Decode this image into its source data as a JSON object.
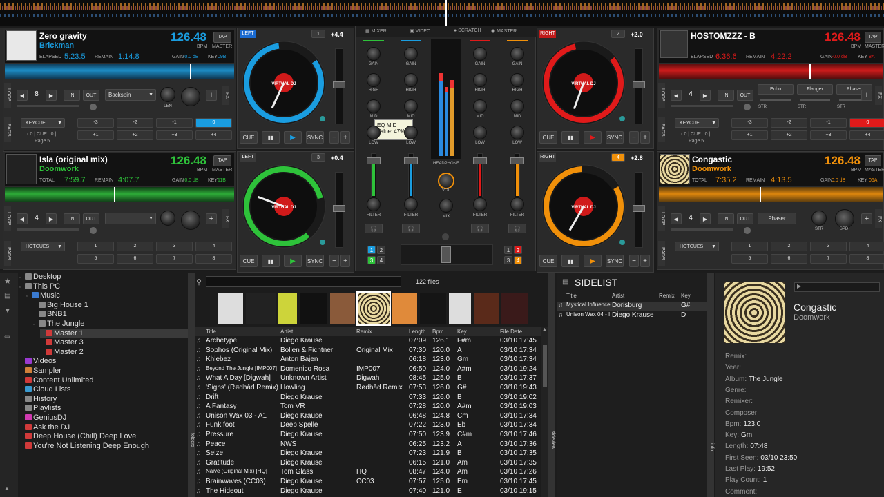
{
  "decks": {
    "d1": {
      "side": "LEFT",
      "num": "1",
      "pitch": "+4.4",
      "title": "Zero gravity",
      "artist": "Brickman",
      "bpm": "126.48",
      "bpm_unit": "BPM",
      "master": "MASTER",
      "tap": "TAP",
      "elapsed_label": "ELAPSED",
      "elapsed": "5:23.5",
      "remain_label": "REMAIN",
      "remain": "1:14.8",
      "gain": "GAIN",
      "gain_val": "-0.0 dB",
      "key": "KEY",
      "key_val": "09B",
      "loop": "8",
      "in": "IN",
      "out": "OUT",
      "effect": "Backspin",
      "len": "LEN",
      "pad_mode": "KEYCUE",
      "pads": [
        "-3",
        "-2",
        "-1",
        "0",
        "+1",
        "+2",
        "+3",
        "+4"
      ],
      "page_info": "♪ 0 | CUE : 0 |",
      "page": "Page 5",
      "color": "#1a9de0"
    },
    "d3": {
      "side": "LEFT",
      "num": "3",
      "pitch": "+0.4",
      "title": "Isla (original mix)",
      "title_extra": "(original mix)",
      "artist": "Doomwork",
      "bpm": "126.48",
      "total_label": "TOTAL",
      "total": "7:59.7",
      "remain": "4:07.7",
      "gain_val": "-0.0 dB",
      "key_val": "11B",
      "loop": "4",
      "pad_mode": "HOTCUES",
      "pads": [
        "1",
        "2",
        "3",
        "4",
        "5",
        "6",
        "7",
        "8"
      ],
      "color": "#2ec23a"
    },
    "d2": {
      "side": "RIGHT",
      "num": "2",
      "pitch": "+2.0",
      "title": "HOSTOMZZZ - B",
      "bpm": "126.48",
      "elapsed": "6:36.6",
      "remain": "4:22.2",
      "gain_val": "-0.0 dB",
      "key_val": "8A",
      "loop": "4",
      "effects": [
        "Echo",
        "Flanger",
        "Phaser"
      ],
      "str": "STR",
      "pad_mode": "KEYCUE",
      "pads": [
        "-3",
        "-2",
        "-1",
        "0",
        "+1",
        "+2",
        "+3",
        "+4"
      ],
      "page_info": "♪ 0 | CUE : 0 |",
      "page": "Page 5",
      "color": "#e01a1a"
    },
    "d4": {
      "side": "RIGHT",
      "num": "4",
      "pitch": "+2.8",
      "title": "Congastic",
      "artist": "Doomwork",
      "bpm": "126.48",
      "total": "7:35.2",
      "remain": "4:13.5",
      "gain_val": "0.0 dB",
      "key_val": "06A",
      "loop": "4",
      "effect": "Phaser",
      "str": "STR",
      "spd": "SPD",
      "pad_mode": "HOTCUES",
      "pads": [
        "1",
        "2",
        "3",
        "4",
        "5",
        "6",
        "7",
        "8"
      ],
      "color": "#f0900a"
    }
  },
  "transport": {
    "cue": "CUE",
    "pause": "▮▮",
    "play": "▶",
    "sync": "SYNC",
    "minus": "−",
    "plus": "+"
  },
  "mixer": {
    "tabs": [
      "MIXER",
      "VIDEO",
      "SCRATCH",
      "MASTER"
    ],
    "gain": "GAIN",
    "high": "HIGH",
    "mid": "MID",
    "low": "LOW",
    "filter": "FILTER",
    "headphone": "HEADPHONE",
    "vol": "VOL",
    "mix": "MIX",
    "tooltip_title": "EQ MID",
    "tooltip_value": "Value: 47%",
    "deck_nums": [
      "1",
      "2",
      "3",
      "4"
    ]
  },
  "side_labels": {
    "loop": "LOOP",
    "pads": "PADS",
    "fx": "FX",
    "folders": "folders",
    "sideview": "sideview",
    "info": "info"
  },
  "browser": {
    "search_placeholder": "",
    "file_count": "122 files",
    "tree": [
      {
        "label": "Desktop",
        "indent": 0,
        "color": "#888"
      },
      {
        "label": "This PC",
        "indent": 0,
        "color": "#888"
      },
      {
        "label": "Music",
        "indent": 1,
        "color": "#3a7ad0"
      },
      {
        "label": "Big House 1",
        "indent": 2,
        "color": "#888"
      },
      {
        "label": "BNB1",
        "indent": 2,
        "color": "#888"
      },
      {
        "label": "The Jungle",
        "indent": 2,
        "color": "#888"
      },
      {
        "label": "Master 1",
        "indent": 3,
        "color": "#d03a3a",
        "selected": true
      },
      {
        "label": "Master 3",
        "indent": 3,
        "color": "#d03a3a"
      },
      {
        "label": "Master 2",
        "indent": 3,
        "color": "#d03a3a"
      },
      {
        "label": "Videos",
        "indent": 0,
        "color": "#9a3ad0"
      },
      {
        "label": "Sampler",
        "indent": 0,
        "color": "#d0803a"
      },
      {
        "label": "Content Unlimited",
        "indent": 0,
        "color": "#d03a3a"
      },
      {
        "label": "Cloud Lists",
        "indent": 0,
        "color": "#3a9ad0"
      },
      {
        "label": "History",
        "indent": 0,
        "color": "#888"
      },
      {
        "label": "Playlists",
        "indent": 0,
        "color": "#888"
      },
      {
        "label": "GeniusDJ",
        "indent": 0,
        "color": "#d03ab0"
      },
      {
        "label": "Ask the DJ",
        "indent": 0,
        "color": "#d03a3a"
      },
      {
        "label": "Deep House (Chill) Deep Love",
        "indent": 0,
        "color": "#d03a3a"
      },
      {
        "label": "You're Not Listening Deep Enough",
        "indent": 0,
        "color": "#d03a3a"
      }
    ],
    "columns": [
      "Title",
      "Artist",
      "Remix",
      "Length",
      "Bpm",
      "Key",
      "File Date"
    ],
    "rows": [
      [
        "Archetype",
        "Diego Krause",
        "",
        "07:09",
        "126.1",
        "F#m",
        "03/10 17:45"
      ],
      [
        "Sophos (Original Mix)",
        "Bollen & Fichtner",
        "Original Mix",
        "07:30",
        "120.0",
        "A",
        "03/10 17:34"
      ],
      [
        "Khlebez",
        "Anton Bajen",
        "",
        "06:18",
        "123.0",
        "Gm",
        "03/10 17:34"
      ],
      [
        "Beyond The Jungle [IMP007]",
        "Domenico Rosa",
        "IMP007",
        "06:50",
        "124.0",
        "A#m",
        "03/10 19:24"
      ],
      [
        "What A Day [Digwah]",
        "Unknown Artist",
        "Digwah",
        "08:45",
        "125.0",
        "B",
        "03/10 17:37"
      ],
      [
        "'Signs' (Rødhåd Remix)",
        "Howling",
        "Rødhåd Remix",
        "07:53",
        "126.0",
        "G#",
        "03/10 19:43"
      ],
      [
        "Drift",
        "Diego Krause",
        "",
        "07:33",
        "126.0",
        "B",
        "03/10 19:02"
      ],
      [
        "A Fantasy",
        "Tom VR",
        "",
        "07:28",
        "120.0",
        "A#m",
        "03/10 19:03"
      ],
      [
        "Unison Wax 03 - A1",
        "Diego Krause",
        "",
        "06:48",
        "124.8",
        "Cm",
        "03/10 17:34"
      ],
      [
        "Funk foot",
        "Deep Spelle",
        "",
        "07:22",
        "123.0",
        "Eb",
        "03/10 17:34"
      ],
      [
        "Pressure",
        "Diego Krause",
        "",
        "07:50",
        "123.9",
        "C#m",
        "03/10 17:46"
      ],
      [
        "Peace",
        "NWS",
        "",
        "06:25",
        "123.2",
        "A",
        "03/10 17:36"
      ],
      [
        "Seize",
        "Diego Krause",
        "",
        "07:23",
        "121.9",
        "B",
        "03/10 17:35"
      ],
      [
        "Gratitude",
        "Diego Krause",
        "",
        "06:15",
        "121.0",
        "Am",
        "03/10 17:35"
      ],
      [
        "Naive (Original Mix) [HQ]",
        "Tom Glass",
        "HQ",
        "08:47",
        "124.0",
        "Am",
        "03/10 17:26"
      ],
      [
        "Brainwaves (CC03)",
        "Diego Krause",
        "CC03",
        "07:57",
        "125.0",
        "Em",
        "03/10 17:45"
      ],
      [
        "The Hideout",
        "Diego Krause",
        "",
        "07:40",
        "121.0",
        "E",
        "03/10 19:15"
      ]
    ]
  },
  "sidelist": {
    "title": "SIDELIST",
    "columns": [
      "Title",
      "Artist",
      "Remix",
      "Key"
    ],
    "rows": [
      [
        "Mystical Influence",
        "Dorisburg",
        "",
        "G#"
      ],
      [
        "Unison Wax 04 - I...",
        "Diego Krause",
        "",
        "D"
      ]
    ]
  },
  "info": {
    "title": "Congastic",
    "artist": "Doomwork",
    "fields": [
      {
        "k": "Remix:",
        "v": ""
      },
      {
        "k": "Year:",
        "v": ""
      },
      {
        "k": "Album:",
        "v": "The Jungle"
      },
      {
        "k": "Genre:",
        "v": ""
      },
      {
        "k": "Remixer:",
        "v": ""
      },
      {
        "k": "Composer:",
        "v": ""
      },
      {
        "k": "Bpm:",
        "v": "123.0"
      },
      {
        "k": "Key:",
        "v": "Gm"
      },
      {
        "k": "Length:",
        "v": "07:48"
      },
      {
        "k": "First Seen:",
        "v": "03/10 23:50"
      },
      {
        "k": "Last Play:",
        "v": "19:52"
      },
      {
        "k": "Play Count:",
        "v": "1"
      },
      {
        "k": "Comment:",
        "v": ""
      }
    ]
  },
  "colors": {
    "deck1": "#1a9de0",
    "deck2": "#e01a1a",
    "deck3": "#2ec23a",
    "deck4": "#f0900a"
  }
}
